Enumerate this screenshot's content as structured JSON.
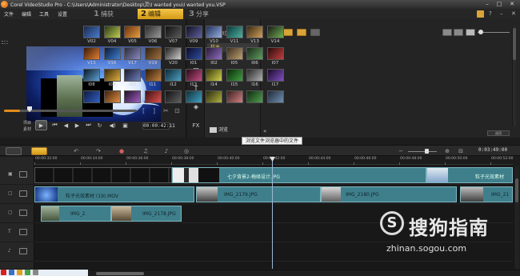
{
  "app": {
    "title": "Corel VideoStudio Pro - C:\\Users\\Administrator\\Desktop\\灵\\I wanted you\\I wanted you.VSP"
  },
  "menu": [
    "文件",
    "编辑",
    "工具",
    "设置"
  ],
  "steps": [
    {
      "num": "1",
      "label": "捕获"
    },
    {
      "num": "2",
      "label": "编辑"
    },
    {
      "num": "3",
      "label": "分享"
    }
  ],
  "preview": {
    "mode_project": "项目",
    "mode_clip": "素材",
    "timecode": "00:00:42:11"
  },
  "library": {
    "add_label": "添加",
    "folder_item": "样本",
    "browse_label": "浏览",
    "tooltip": "浏览文件浏览器中的文件",
    "bottom_button": "选项",
    "thumbs": [
      "V02",
      "V04",
      "V05",
      "V06",
      "V07",
      "V09",
      "V10",
      "V11",
      "V13",
      "V14",
      "V15",
      "V16",
      "V17",
      "V19",
      "V20",
      "I01",
      "I02",
      "I05",
      "I06",
      "I07",
      "I08",
      "I09",
      "I10",
      "I11",
      "I12",
      "I13",
      "I14",
      "I15",
      "I16",
      "I17",
      "",
      "",
      "",
      "",
      "",
      "",
      "",
      "",
      "",
      ""
    ]
  },
  "timeline": {
    "timecode": "0:03:49:00",
    "ruler": [
      "00:00:32:00",
      "00:00:34:00",
      "00:00:36:00",
      "00:00:38:00",
      "00:00:40:00",
      "00:00:42:00",
      "00:00:44:00",
      "00:00:46:00",
      "00:00:48:00",
      "00:00:50:00",
      "00:00:52:00"
    ],
    "clips": {
      "r0_c1": "七夕背景2-梅绎设计.JPG",
      "r0_c3": "粒子光效素材",
      "r1_c1": "粒子光效素材 (19).MOV",
      "r1_c2": "IMG_2179.JPG",
      "r1_c3": "IMG_2180.JPG",
      "r1_c4": "IMG_21",
      "r2_c1": "IMG_2",
      "r2_c2": "IMG_2178.JPG"
    }
  },
  "watermark": {
    "brand": "搜狗指南",
    "url": "zhinan.sogou.com"
  },
  "colors": {
    "accent": "#e8a41f",
    "clip": "#3f7f8c",
    "background": "#1c1c1c"
  }
}
